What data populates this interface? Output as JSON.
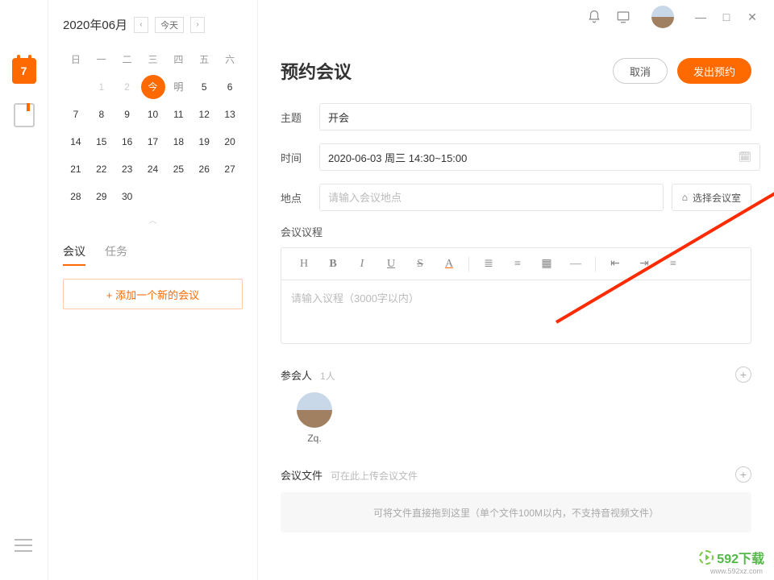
{
  "leftbar": {
    "calendar_day": "7"
  },
  "sidebar": {
    "month_label": "2020年06月",
    "today_btn": "今天",
    "weekdays": [
      "日",
      "一",
      "二",
      "三",
      "四",
      "五",
      "六"
    ],
    "rows": [
      [
        "",
        "1",
        "2",
        "今",
        "明",
        "5",
        "6"
      ],
      [
        "7",
        "8",
        "9",
        "10",
        "11",
        "12",
        "13"
      ],
      [
        "14",
        "15",
        "16",
        "17",
        "18",
        "19",
        "20"
      ],
      [
        "21",
        "22",
        "23",
        "24",
        "25",
        "26",
        "27"
      ],
      [
        "28",
        "29",
        "30",
        "",
        "",
        "",
        ""
      ]
    ],
    "today_index": [
      0,
      3
    ],
    "tabs": {
      "meetings": "会议",
      "tasks": "任务"
    },
    "add_btn": "+  添加一个新的会议"
  },
  "main": {
    "title": "预约会议",
    "cancel": "取消",
    "submit": "发出预约",
    "form": {
      "subject_label": "主题",
      "subject_value": "开会",
      "time_label": "时间",
      "time_value": "2020-06-03 周三 14:30~15:00",
      "location_label": "地点",
      "location_placeholder": "请输入会议地点",
      "room_btn": "选择会议室"
    },
    "agenda": {
      "label": "会议议程",
      "placeholder": "请输入议程（3000字以内）"
    },
    "attendees": {
      "label": "参会人",
      "count": "1人",
      "list": [
        {
          "name": "Zq."
        }
      ]
    },
    "files": {
      "label": "会议文件",
      "hint": "可在此上传会议文件",
      "dropzone": "可将文件直接拖到这里（单个文件100M以内，不支持音视频文件）"
    }
  },
  "watermark": {
    "text": "592下载",
    "url": "www.592xz.com"
  }
}
